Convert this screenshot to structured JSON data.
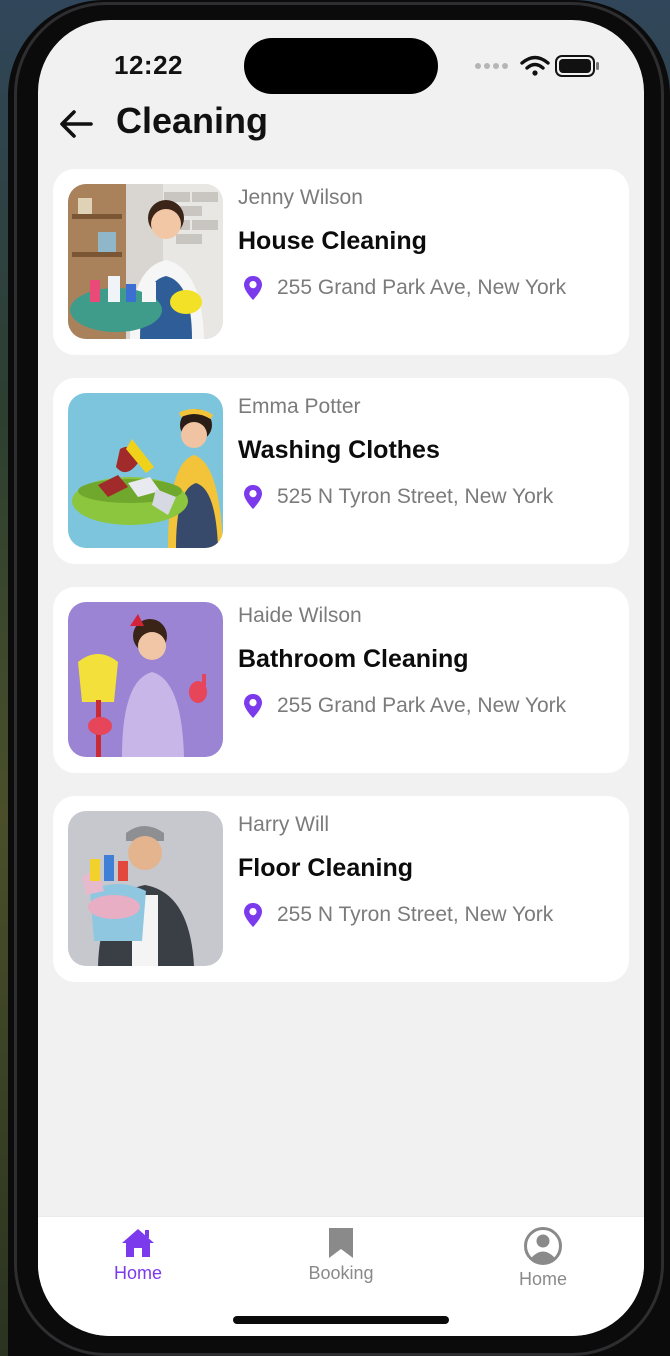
{
  "status_bar": {
    "time": "12:22"
  },
  "header": {
    "title": "Cleaning",
    "back_icon": "arrow-left-icon"
  },
  "theme": {
    "accent": "#7c3aed",
    "card_bg": "#ffffff",
    "page_bg": "#f1f1f1",
    "muted_text": "#7b7b7b"
  },
  "services": [
    {
      "provider": "Jenny Wilson",
      "service": "House Cleaning",
      "address": "255 Grand Park Ave, New York"
    },
    {
      "provider": "Emma Potter",
      "service": "Washing Clothes",
      "address": "525 N Tyron Street, New York"
    },
    {
      "provider": "Haide Wilson",
      "service": "Bathroom Cleaning",
      "address": "255 Grand Park Ave, New York"
    },
    {
      "provider": "Harry Will",
      "service": "Floor Cleaning",
      "address": "255 N Tyron Street, New York"
    }
  ],
  "tabbar": {
    "items": [
      {
        "label": "Home",
        "icon": "house-icon",
        "active": true
      },
      {
        "label": "Booking",
        "icon": "bookmark-icon",
        "active": false
      },
      {
        "label": "Home",
        "icon": "user-circle-icon",
        "active": false
      }
    ]
  }
}
